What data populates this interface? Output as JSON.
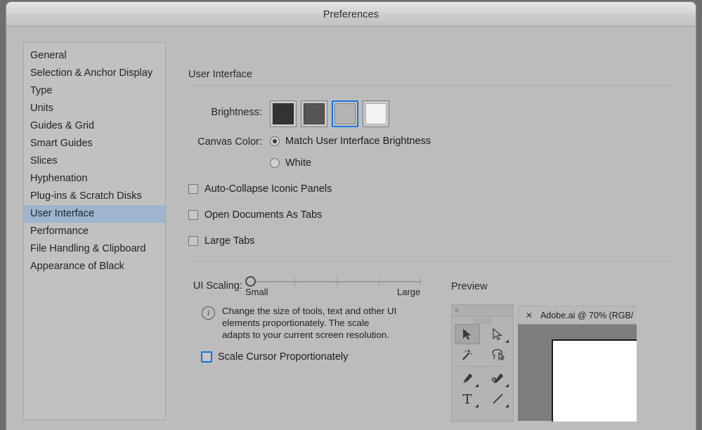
{
  "window": {
    "title": "Preferences"
  },
  "sidebar": {
    "items": [
      {
        "label": "General",
        "selected": false
      },
      {
        "label": "Selection & Anchor Display",
        "selected": false
      },
      {
        "label": "Type",
        "selected": false
      },
      {
        "label": "Units",
        "selected": false
      },
      {
        "label": "Guides & Grid",
        "selected": false
      },
      {
        "label": "Smart Guides",
        "selected": false
      },
      {
        "label": "Slices",
        "selected": false
      },
      {
        "label": "Hyphenation",
        "selected": false
      },
      {
        "label": "Plug-ins & Scratch Disks",
        "selected": false
      },
      {
        "label": "User Interface",
        "selected": true
      },
      {
        "label": "Performance",
        "selected": false
      },
      {
        "label": "File Handling & Clipboard",
        "selected": false
      },
      {
        "label": "Appearance of Black",
        "selected": false
      }
    ]
  },
  "main": {
    "section_title": "User Interface",
    "brightness": {
      "label": "Brightness:",
      "selected_index": 2,
      "swatches": [
        {
          "name": "dark",
          "color": "#333333"
        },
        {
          "name": "medium-dark",
          "color": "#555555"
        },
        {
          "name": "light",
          "color": "#b4b4b4"
        },
        {
          "name": "white",
          "color": "#f2f2f2"
        }
      ],
      "accent_color": "#1473e6"
    },
    "canvas_color": {
      "label": "Canvas Color:",
      "options": [
        {
          "label": "Match User Interface Brightness",
          "selected": true
        },
        {
          "label": "White",
          "selected": false
        }
      ]
    },
    "checkboxes": [
      {
        "label": "Auto-Collapse Iconic Panels",
        "checked": false
      },
      {
        "label": "Open Documents As Tabs",
        "checked": false
      },
      {
        "label": "Large Tabs",
        "checked": false
      }
    ],
    "ui_scaling": {
      "label": "UI Scaling:",
      "min_label": "Small",
      "max_label": "Large",
      "value_position": "0",
      "info_icon": "info-icon",
      "info_text": "Change the size of tools, text and other UI elements proportionately. The scale adapts to your current screen resolution.",
      "scale_cursor": {
        "label": "Scale Cursor Proportionately",
        "checked": false,
        "focused": true
      }
    },
    "preview": {
      "title": "Preview",
      "collapse_label": "«",
      "grip_label": "||||||||",
      "tools": [
        {
          "name": "selection-tool-icon",
          "active": true
        },
        {
          "name": "direct-selection-tool-icon",
          "active": false
        },
        {
          "name": "magic-wand-tool-icon",
          "active": false
        },
        {
          "name": "lasso-tool-icon",
          "active": false
        },
        {
          "name": "pen-tool-icon",
          "active": false
        },
        {
          "name": "curvature-pen-tool-icon",
          "active": false
        },
        {
          "name": "type-tool-icon",
          "active": false
        },
        {
          "name": "line-segment-tool-icon",
          "active": false
        }
      ],
      "document_tab": {
        "close_glyph": "✕",
        "label": "Adobe.ai @ 70% (RGB/"
      }
    }
  }
}
